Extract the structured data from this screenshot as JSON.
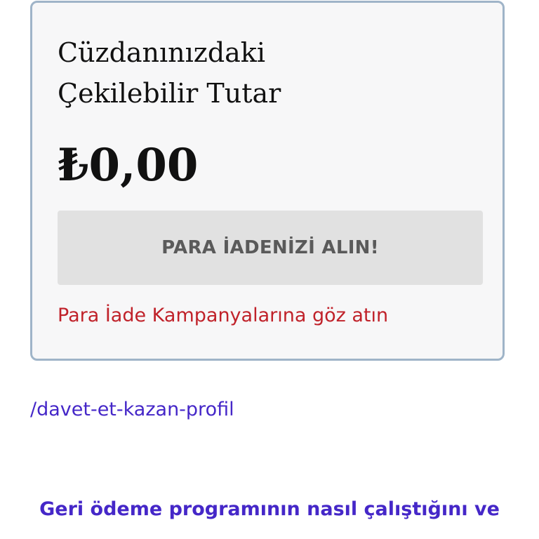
{
  "wallet": {
    "title_line1": "Cüzdanınızdaki",
    "title_line2": "Çekilebilir Tutar",
    "amount": "₺0,00",
    "refund_button_label": "PARA İADENİZİ ALIN!",
    "campaign_link_text": "Para İade Kampanyalarına göz atın"
  },
  "referral": {
    "link_text": "/davet-et-kazan-profil"
  },
  "cashback_section": {
    "heading": "Geri ödeme programının nasıl çalıştığını ve"
  },
  "colors": {
    "card_background": "#f7f7f8",
    "card_border": "#9fb4c8",
    "button_background": "#e1e1e1",
    "button_text": "#5a5a5a",
    "campaign_link": "#c0222a",
    "primary_link": "#4527c8"
  }
}
